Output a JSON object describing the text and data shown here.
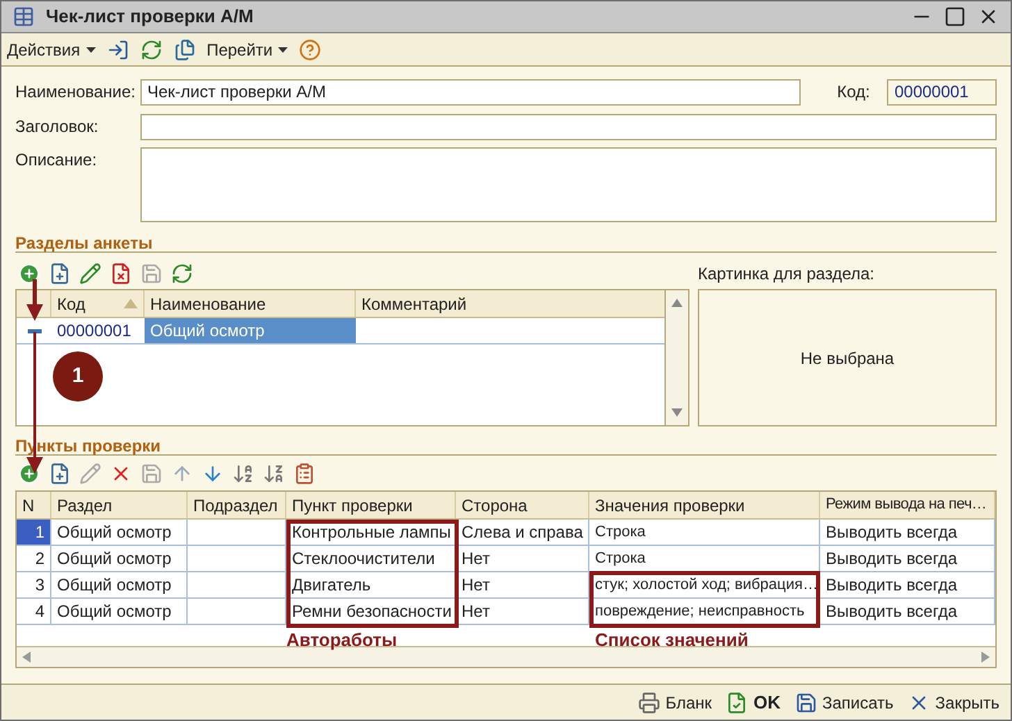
{
  "window": {
    "title": "Чек-лист проверки А/М"
  },
  "toolbar": {
    "actions": "Действия",
    "goto": "Перейти"
  },
  "form": {
    "name_label": "Наименование:",
    "name_value": "Чек-лист проверки А/М",
    "code_label": "Код:",
    "code_value": "00000001",
    "header_label": "Заголовок:",
    "description_label": "Описание:"
  },
  "sections": {
    "title": "Разделы анкеты",
    "columns": [
      "Код",
      "Наименование",
      "Комментарий"
    ],
    "rows": [
      {
        "code": "00000001",
        "name": "Общий осмотр",
        "selected": true
      }
    ],
    "picture_label": "Картинка для раздела:",
    "picture_value": "Не выбрана"
  },
  "items": {
    "title": "Пункты проверки",
    "columns": [
      "N",
      "Раздел",
      "Подраздел",
      "Пункт проверки",
      "Сторона",
      "Значения проверки",
      "Режим вывода на печ…"
    ],
    "rows": [
      {
        "n": "1",
        "section": "Общий осмотр",
        "point": "Контрольные лампы",
        "side": "Слева и справа",
        "values": "Строка",
        "mode": "Выводить всегда",
        "selected": true
      },
      {
        "n": "2",
        "section": "Общий осмотр",
        "point": "Стеклоочистители",
        "side": "Нет",
        "values": "Строка",
        "mode": "Выводить всегда",
        "selected": false
      },
      {
        "n": "3",
        "section": "Общий осмотр",
        "point": "Двигатель",
        "side": "Нет",
        "values": "стук; холостой ход; вибрация…",
        "mode": "Выводить всегда",
        "selected": false
      },
      {
        "n": "4",
        "section": "Общий осмотр",
        "point": "Ремни безопасности",
        "side": "Нет",
        "values": "повреждение; неисправность",
        "mode": "Выводить всегда",
        "selected": false
      }
    ]
  },
  "annotations": {
    "badge": "1",
    "points_label": "Автоработы",
    "values_label": "Список значений"
  },
  "footer": {
    "print": "Бланк",
    "ok": "OK",
    "save": "Записать",
    "close": "Закрыть"
  }
}
